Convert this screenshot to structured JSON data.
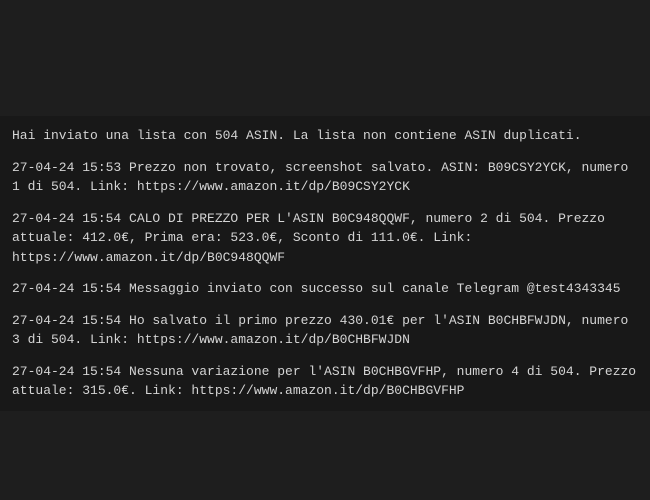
{
  "terminal": {
    "header": "Hai inviato una lista con 504 ASIN. La lista non contiene ASIN duplicati.",
    "entries": [
      "27-04-24 15:53 Prezzo non trovato, screenshot salvato. ASIN: B09CSY2YCK, numero 1 di 504. Link: https://www.amazon.it/dp/B09CSY2YCK",
      "27-04-24 15:54 CALO DI PREZZO PER L'ASIN B0C948QQWF, numero 2 di 504. Prezzo attuale: 412.0€, Prima era: 523.0€, Sconto di 111.0€. Link: https://www.amazon.it/dp/B0C948QQWF",
      "27-04-24 15:54 Messaggio inviato con successo sul canale Telegram @test4343345",
      "27-04-24 15:54 Ho salvato il primo prezzo 430.01€ per l'ASIN B0CHBFWJDN, numero 3 di 504. Link: https://www.amazon.it/dp/B0CHBFWJDN",
      "27-04-24 15:54 Nessuna variazione per l'ASIN B0CHBGVFHP, numero 4 di 504. Prezzo attuale: 315.0€. Link: https://www.amazon.it/dp/B0CHBGVFHP"
    ]
  }
}
